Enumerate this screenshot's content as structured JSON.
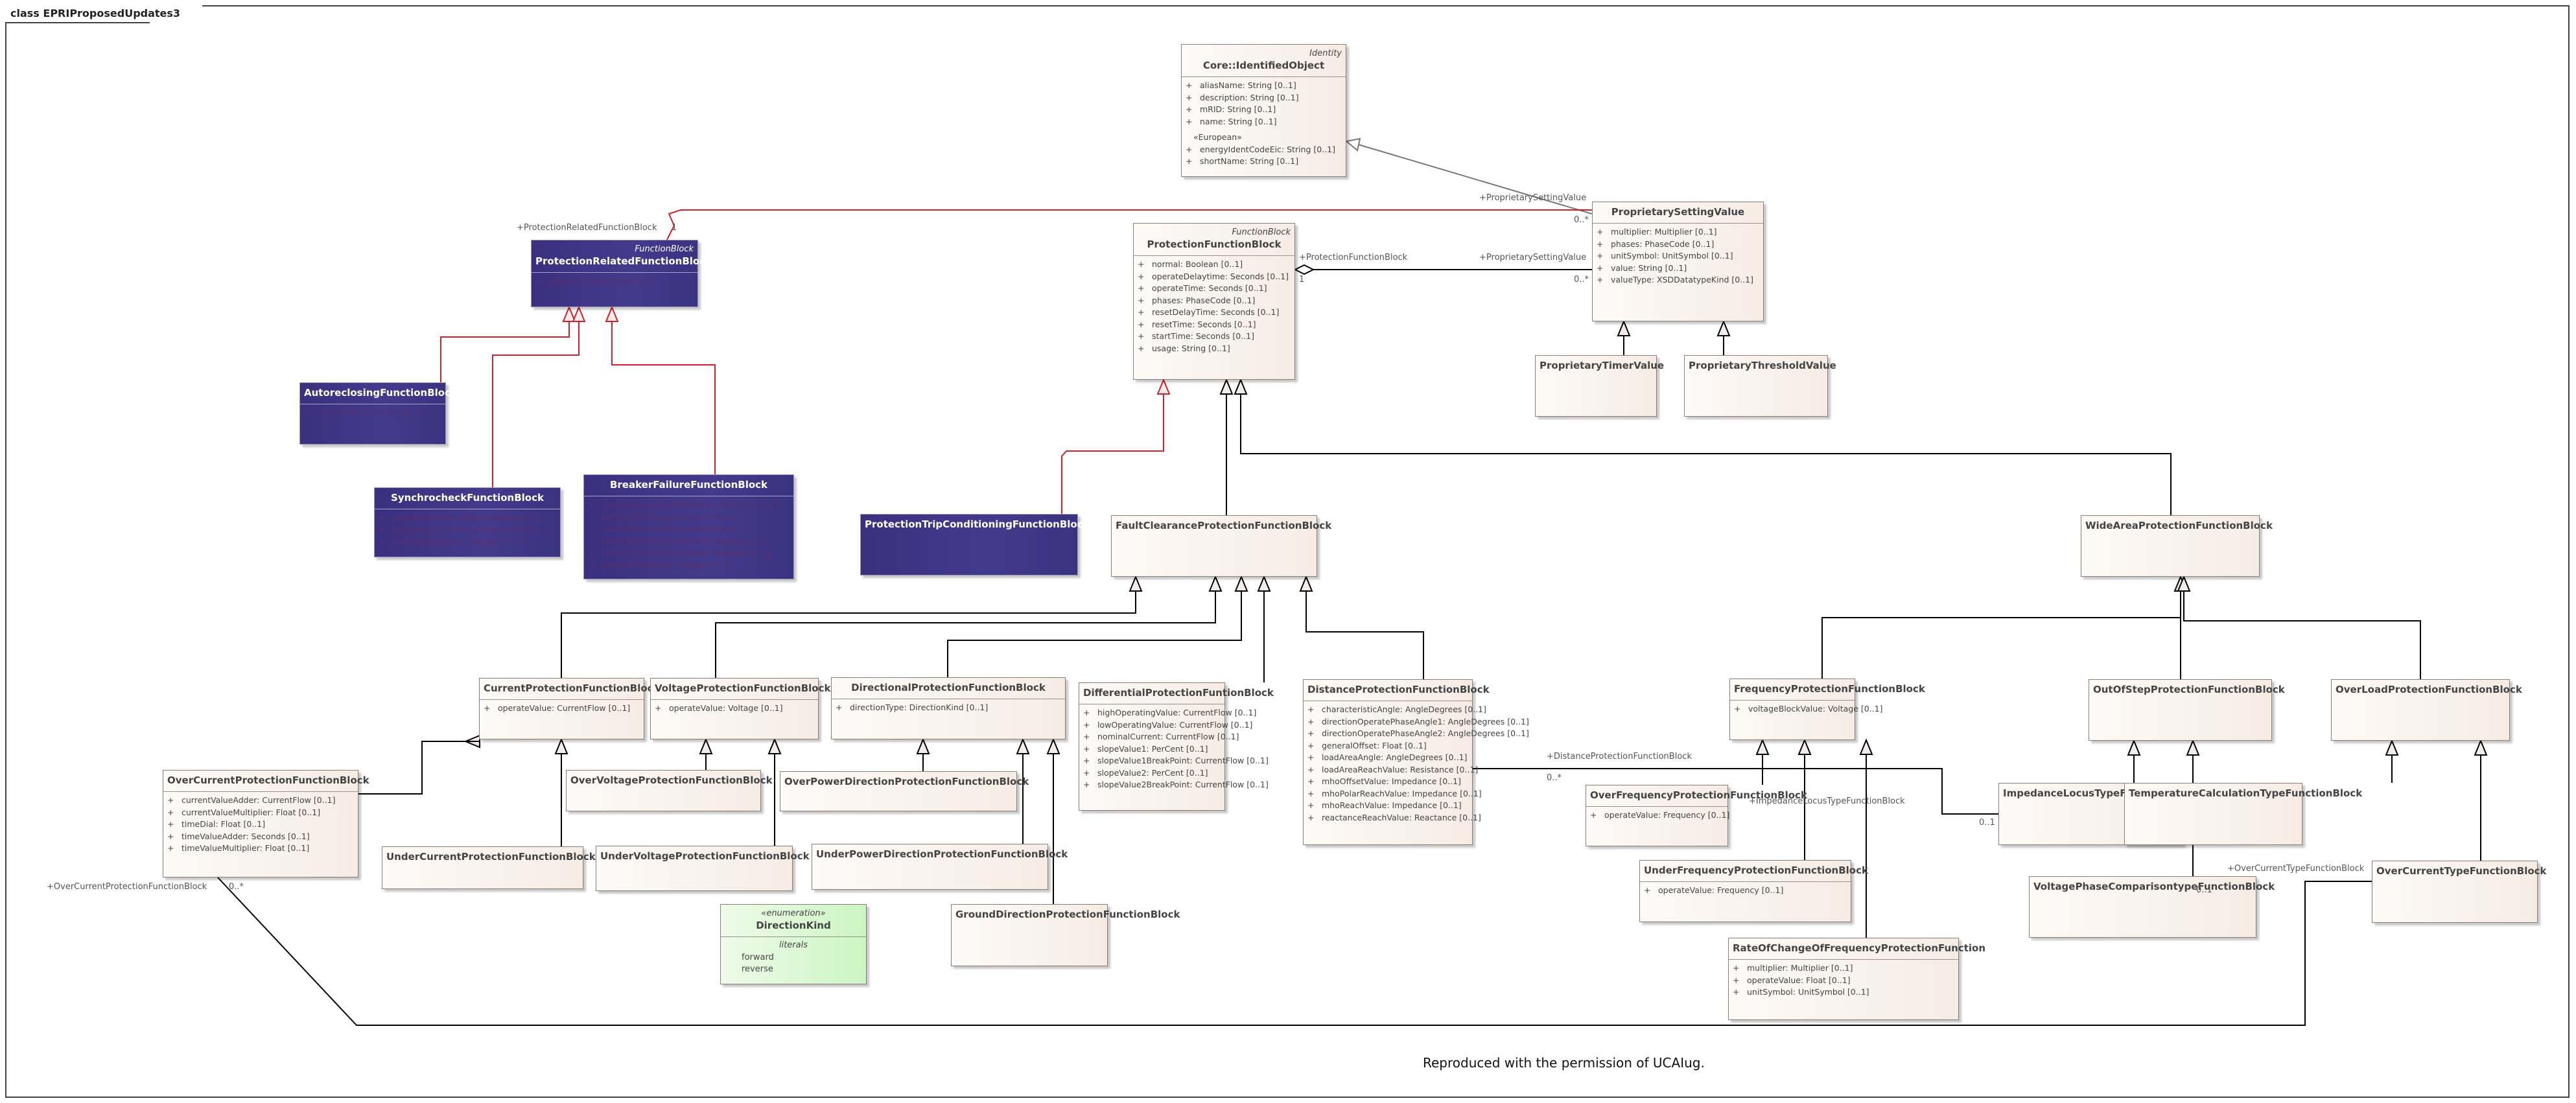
{
  "diagram": {
    "frame_title": "class EPRIProposedUpdates3",
    "footer": "Reproduced with the permission of UCAIug.",
    "colors": {
      "class_fill_light": "#fdfaf7",
      "class_fill_dark": "#f6ece4",
      "proprietary_fill": "#3b307f",
      "enumeration_fill": "#ccf5c3",
      "generalization_line": "#000000",
      "red_line": "#d0202a"
    }
  },
  "classes": {
    "identifiedObject": {
      "stereotype": "Identity",
      "name": "Core::IdentifiedObject",
      "attributes": [
        {
          "vis": "+",
          "text": "aliasName: String [0..1]"
        },
        {
          "vis": "+",
          "text": "description: String [0..1]"
        },
        {
          "vis": "+",
          "text": "mRID: String [0..1]"
        },
        {
          "vis": "+",
          "text": "name: String [0..1]"
        }
      ],
      "group_label": "«European»",
      "group_attributes": [
        {
          "vis": "+",
          "text": "energyIdentCodeEic: String [0..1]"
        },
        {
          "vis": "+",
          "text": "shortName: String [0..1]"
        }
      ]
    },
    "proprietarySettingValue": {
      "name": "ProprietarySettingValue",
      "attributes": [
        {
          "vis": "+",
          "text": "multiplier: Multiplier [0..1]"
        },
        {
          "vis": "+",
          "text": "phases: PhaseCode [0..1]"
        },
        {
          "vis": "+",
          "text": "unitSymbol: UnitSymbol [0..1]"
        },
        {
          "vis": "+",
          "text": "value: String [0..1]"
        },
        {
          "vis": "+",
          "text": "valueType: XSDDatatypeKind [0..1]"
        }
      ]
    },
    "proprietaryTimerValue": {
      "name": "ProprietaryTimerValue"
    },
    "proprietaryThresholdValue": {
      "name": "ProprietaryThresholdValue"
    },
    "protectionFunctionBlock": {
      "stereotype": "FunctionBlock",
      "name": "ProtectionFunctionBlock",
      "attributes": [
        {
          "vis": "+",
          "text": "normal: Boolean [0..1]"
        },
        {
          "vis": "+",
          "text": "operateDelaytime: Seconds [0..1]"
        },
        {
          "vis": "+",
          "text": "operateTime: Seconds [0..1]"
        },
        {
          "vis": "+",
          "text": "phases: PhaseCode [0..1]"
        },
        {
          "vis": "+",
          "text": "resetDelayTime: Seconds [0..1]"
        },
        {
          "vis": "+",
          "text": "resetTime: Seconds [0..1]"
        },
        {
          "vis": "+",
          "text": "startTime: Seconds [0..1]"
        },
        {
          "vis": "+",
          "text": "usage: String [0..1]"
        }
      ]
    },
    "protectionRelatedFunctionBlock": {
      "stereotype": "FunctionBlock",
      "name": "ProtectionRelatedFunctionBlock",
      "attributes": [
        {
          "vis": "+",
          "text": "phases: PhaseCode [0..1]"
        }
      ]
    },
    "autoreclosingFunctionBlock": {
      "name": "AutoreclosingFunctionBlock",
      "attributes": [
        {
          "vis": "+",
          "text": "resetTime: Seconds [0..1]"
        }
      ]
    },
    "synchrocheckFunctionBlock": {
      "name": "SynchrocheckFunctionBlock",
      "attributes": [
        {
          "vis": "+",
          "text": "angleDifference: AngleDegrees [0..1]"
        },
        {
          "vis": "+",
          "text": "frequencyDifference: Frequency [0..1]"
        },
        {
          "vis": "+",
          "text": "voltageDifference: Voltage [0..1]"
        }
      ]
    },
    "breakerFailureFunctionBlock": {
      "name": "BreakerFailureFunctionBlock",
      "attributes": [
        {
          "vis": "+",
          "text": "additionalBackupTimeDelay: Seconds [0..1]"
        },
        {
          "vis": "+",
          "text": "backupTimeDelay: Seconds [0..1]"
        },
        {
          "vis": "+",
          "text": "currentThreshold: CurrentFlow [0..1]"
        },
        {
          "vis": "+",
          "text": "retripTimeDelaySinglePole: Seconds [0..1]"
        },
        {
          "vis": "+",
          "text": "retripTimeDelayThreePole: Seconds [0..1]"
        },
        {
          "vis": "+",
          "text": "voltageThreshold: Voltage [0..1]"
        }
      ]
    },
    "protectionTripConditioningFunctionBlock": {
      "name": "ProtectionTripConditioningFunctionBlock"
    },
    "faultClearanceProtectionFunctionBlock": {
      "name": "FaultClearanceProtectionFunctionBlock"
    },
    "wideAreaProtectionFunctionBlock": {
      "name": "WideAreaProtectionFunctionBlock"
    },
    "currentProtectionFunctionBlock": {
      "name": "CurrentProtectionFunctionBlock",
      "attributes": [
        {
          "vis": "+",
          "text": "operateValue: CurrentFlow [0..1]"
        }
      ]
    },
    "voltageProtectionFunctionBlock": {
      "name": "VoltageProtectionFunctionBlock",
      "attributes": [
        {
          "vis": "+",
          "text": "operateValue: Voltage [0..1]"
        }
      ]
    },
    "directionalProtectionFunctionBlock": {
      "name": "DirectionalProtectionFunctionBlock",
      "attributes": [
        {
          "vis": "+",
          "text": "directionType: DirectionKind [0..1]"
        }
      ]
    },
    "differentialProtectionFuntionBlock": {
      "name": "DifferentialProtectionFuntionBlock",
      "attributes": [
        {
          "vis": "+",
          "text": "highOperatingValue: CurrentFlow [0..1]"
        },
        {
          "vis": "+",
          "text": "lowOperatingValue: CurrentFlow [0..1]"
        },
        {
          "vis": "+",
          "text": "nominalCurrent: CurrentFlow [0..1]"
        },
        {
          "vis": "+",
          "text": "slopeValue1: PerCent [0..1]"
        },
        {
          "vis": "+",
          "text": "slopeValue1BreakPoint: CurrentFlow [0..1]"
        },
        {
          "vis": "+",
          "text": "slopeValue2: PerCent [0..1]"
        },
        {
          "vis": "+",
          "text": "slopeValue2BreakPoint: CurrentFlow [0..1]"
        }
      ]
    },
    "distanceProtectionFunctionBlock": {
      "name": "DistanceProtectionFunctionBlock",
      "attributes": [
        {
          "vis": "+",
          "text": "characteristicAngle: AngleDegrees [0..1]"
        },
        {
          "vis": "+",
          "text": "directionOperatePhaseAngle1: AngleDegrees [0..1]"
        },
        {
          "vis": "+",
          "text": "directionOperatePhaseAngle2: AngleDegrees [0..1]"
        },
        {
          "vis": "+",
          "text": "generalOffset: Float [0..1]"
        },
        {
          "vis": "+",
          "text": "loadAreaAngle: AngleDegrees [0..1]"
        },
        {
          "vis": "+",
          "text": "loadAreaReachValue: Resistance [0..1]"
        },
        {
          "vis": "+",
          "text": "mhoOffsetValue: Impedance [0..1]"
        },
        {
          "vis": "+",
          "text": "mhoPolarReachValue: Impedance [0..1]"
        },
        {
          "vis": "+",
          "text": "mhoReachValue: Impedance [0..1]"
        },
        {
          "vis": "+",
          "text": "reactanceReachValue: Reactance [0..1]"
        }
      ]
    },
    "frequencyProtectionFunctionBlock": {
      "name": "FrequencyProtectionFunctionBlock",
      "attributes": [
        {
          "vis": "+",
          "text": "voltageBlockValue: Voltage [0..1]"
        }
      ]
    },
    "outOfStepProtectionFunctionBlock": {
      "name": "OutOfStepProtectionFunctionBlock"
    },
    "overLoadProtectionFunctionBlock": {
      "name": "OverLoadProtectionFunctionBlock"
    },
    "overCurrentProtectionFunctionBlock": {
      "name": "OverCurrentProtectionFunctionBlock",
      "attributes": [
        {
          "vis": "+",
          "text": "currentValueAdder: CurrentFlow [0..1]"
        },
        {
          "vis": "+",
          "text": "currentValueMultiplier: Float [0..1]"
        },
        {
          "vis": "+",
          "text": "timeDial: Float [0..1]"
        },
        {
          "vis": "+",
          "text": "timeValueAdder: Seconds [0..1]"
        },
        {
          "vis": "+",
          "text": "timeValueMultiplier: Float [0..1]"
        }
      ]
    },
    "underCurrentProtectionFunctionBlock": {
      "name": "UnderCurrentProtectionFunctionBlock"
    },
    "overVoltageProtectionFunctionBlock": {
      "name": "OverVoltageProtectionFunctionBlock"
    },
    "underVoltageProtectionFunctionBlock": {
      "name": "UnderVoltageProtectionFunctionBlock"
    },
    "overPowerDirectionProtectionFunctionBlock": {
      "name": "OverPowerDirectionProtectionFunctionBlock"
    },
    "underPowerDirectionProtectionFunctionBlock": {
      "name": "UnderPowerDirectionProtectionFunctionBlock"
    },
    "groundDirectionProtectionFunctionBlock": {
      "name": "GroundDirectionProtectionFunctionBlock"
    },
    "directionKind": {
      "stereotype": "«enumeration»",
      "name": "DirectionKind",
      "literals_label": "literals",
      "literals": [
        "forward",
        "reverse"
      ]
    },
    "overFrequencyProtectionFunctionBlock": {
      "name": "OverFrequencyProtectionFunctionBlock",
      "attributes": [
        {
          "vis": "+",
          "text": "operateValue: Frequency [0..1]"
        }
      ]
    },
    "underFrequencyProtectionFunctionBlock": {
      "name": "UnderFrequencyProtectionFunctionBlock",
      "attributes": [
        {
          "vis": "+",
          "text": "operateValue: Frequency [0..1]"
        }
      ]
    },
    "rateOfChangeOfFrequencyProtectionFunction": {
      "name": "RateOfChangeOfFrequencyProtectionFunction",
      "attributes": [
        {
          "vis": "+",
          "text": "multiplier: Multiplier [0..1]"
        },
        {
          "vis": "+",
          "text": "operateValue: Float [0..1]"
        },
        {
          "vis": "+",
          "text": "unitSymbol: UnitSymbol [0..1]"
        }
      ]
    },
    "impedanceLocusTypeFunctionBlock": {
      "name": "ImpedanceLocusTypeFunctionBlock"
    },
    "voltagePhaseComparisontypeFunctionBlock": {
      "name": "VoltagePhaseComparisontypeFunctionBlock"
    },
    "temperatureCalculationTypeFunctionBlock": {
      "name": "TemperatureCalculationTypeFunctionBlock"
    },
    "overCurrentTypeFunctionBlock": {
      "name": "OverCurrentTypeFunctionBlock"
    }
  },
  "association_labels": {
    "protectionRelatedRole": "+ProtectionRelatedFunctionBlock",
    "protectionRelatedMult": "1",
    "proprietarySettingRoleTop": "+ProprietarySettingValue",
    "proprietarySettingMultTop": "0..*",
    "protectionFunctionBlockRole": "+ProtectionFunctionBlock",
    "protectionFunctionBlockMult": "1",
    "proprietarySettingRoleMid": "+ProprietarySettingValue",
    "proprietarySettingMultMid": "0..*",
    "distanceRole": "+DistanceProtectionFunctionBlock",
    "distanceMult": "0..*",
    "impedanceLocusRole": "+ImpedanceLocusTypeFunctionBlock",
    "impedanceLocusMult": "0..1",
    "overCurrentProtRole": "+OverCurrentProtectionFunctionBlock",
    "overCurrentProtMult": "0..*",
    "overCurrentTypeRole": "+OverCurrentTypeFunctionBlock",
    "overCurrentTypeMult": "0..1"
  }
}
